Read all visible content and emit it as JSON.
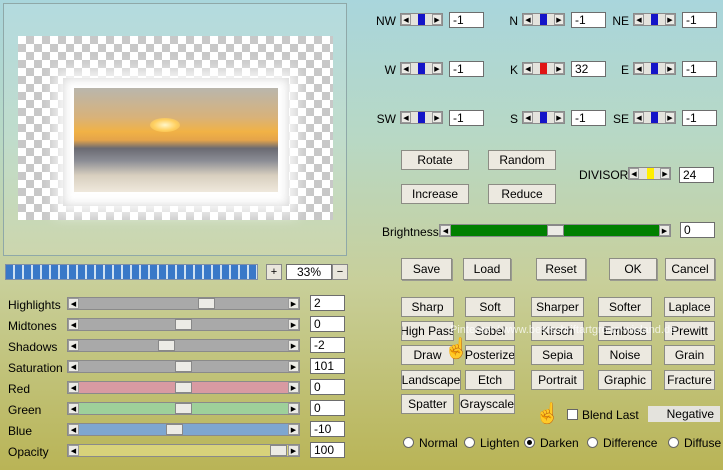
{
  "preview": {
    "zoom_value": "33%",
    "zoom_in": "+",
    "zoom_out": "−",
    "progress": 1.0
  },
  "adjust": {
    "rows": [
      {
        "label": "Highlights",
        "value": "2",
        "level": 0.62,
        "color": "#a9a9a9"
      },
      {
        "label": "Midtones",
        "value": "0",
        "level": 0.5,
        "color": "#a9a9a9"
      },
      {
        "label": "Shadows",
        "value": "-2",
        "level": 0.41,
        "color": "#a9a9a9"
      },
      {
        "label": "Saturation",
        "value": "101",
        "level": 0.5,
        "color": "#a9a9a9"
      },
      {
        "label": "Red",
        "value": "0",
        "level": 0.5,
        "color": "#d89aa2"
      },
      {
        "label": "Green",
        "value": "0",
        "level": 0.5,
        "color": "#9ed09a"
      },
      {
        "label": "Blue",
        "value": "-10",
        "level": 0.45,
        "color": "#7ea6d0"
      },
      {
        "label": "Opacity",
        "value": "100",
        "level": 1.0,
        "color": "#d8d27a"
      }
    ]
  },
  "matrix": {
    "cells": [
      {
        "label": "NW",
        "value": "-1",
        "bar": "#1414c8"
      },
      {
        "label": "N",
        "value": "-1",
        "bar": "#1414c8"
      },
      {
        "label": "NE",
        "value": "-1",
        "bar": "#1414c8"
      },
      {
        "label": "W",
        "value": "-1",
        "bar": "#1414c8"
      },
      {
        "label": "K",
        "value": "32",
        "bar": "#e01414"
      },
      {
        "label": "E",
        "value": "-1",
        "bar": "#1414c8"
      },
      {
        "label": "SW",
        "value": "-1",
        "bar": "#1414c8"
      },
      {
        "label": "S",
        "value": "-1",
        "bar": "#1414c8"
      },
      {
        "label": "SE",
        "value": "-1",
        "bar": "#1414c8"
      }
    ]
  },
  "actions": {
    "rotate": "Rotate",
    "random": "Random",
    "increase": "Increase",
    "reduce": "Reduce",
    "divisor_label": "DIVISOR",
    "divisor_value": "24",
    "divisor_bar": "#ffee00"
  },
  "brightness": {
    "label": "Brightness",
    "value": "0",
    "level": 0.5,
    "color": "#008000"
  },
  "dialog": {
    "save": "Save",
    "load": "Load",
    "reset": "Reset",
    "ok": "OK",
    "cancel": "Cancel"
  },
  "presets": [
    [
      "Sharp",
      "Soft",
      "Sharper",
      "Softer",
      "Laplace"
    ],
    [
      "High Pass",
      "Sobel",
      "Kirsch",
      "Emboss",
      "Prewitt"
    ],
    [
      "Draw",
      "Posterize",
      "Sepia",
      "Noise",
      "Grain"
    ],
    [
      "Landscape",
      "Etch",
      "Portrait",
      "Graphic",
      "Fracture"
    ],
    [
      "Spatter",
      "Grayscale"
    ]
  ],
  "blend_last": "Blend Last",
  "negative": "Negative",
  "modes": [
    "Normal",
    "Lighten",
    "Darken",
    "Difference",
    "Diffuse"
  ],
  "selected_mode": "Darken",
  "watermark": "Pinterest / www.bestschriftartgroup-wieland.de",
  "icons": {
    "pointer": "hand-pointer-icon"
  }
}
